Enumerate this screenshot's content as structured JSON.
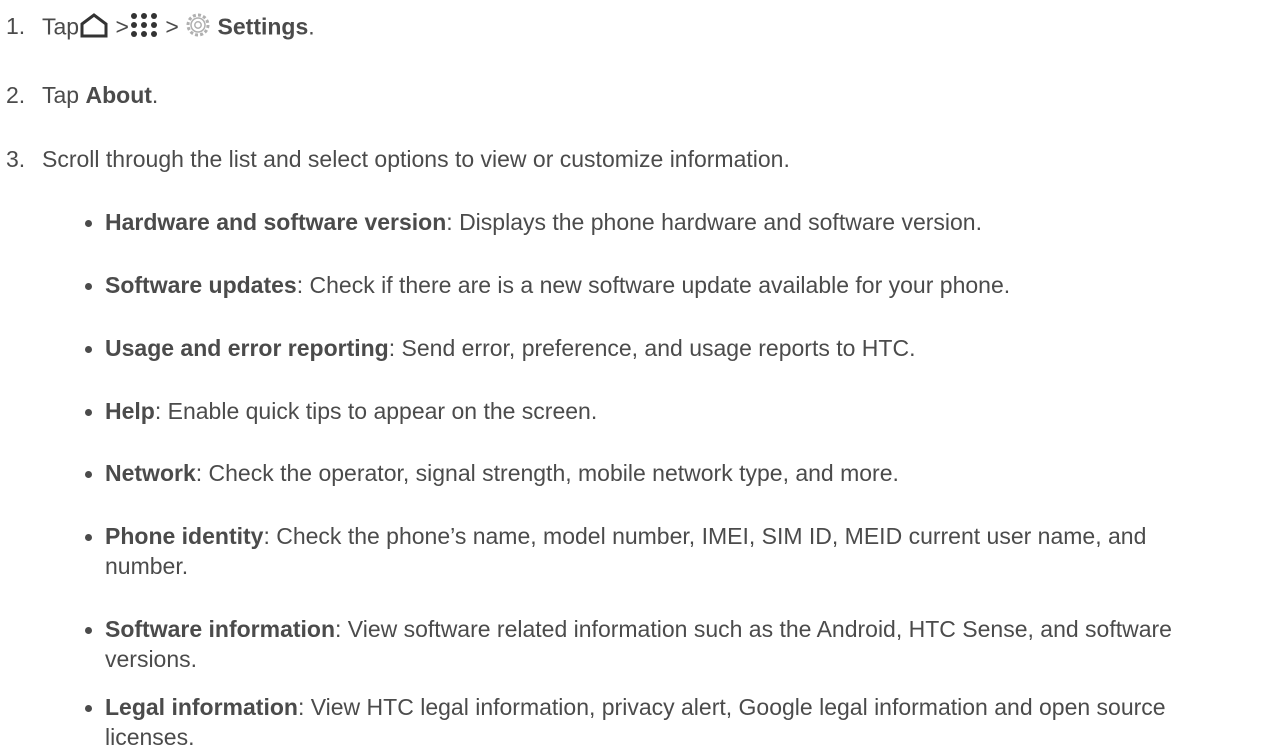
{
  "steps": [
    {
      "num": "1.",
      "parts": {
        "pre": "Tap",
        "sep1": ">",
        "sep2": ">",
        "label": "Settings",
        "post": "."
      },
      "icons": [
        "home-icon",
        "apps-grid-icon",
        "settings-gear-icon"
      ]
    },
    {
      "num": "2.",
      "pre": "Tap ",
      "bold": "About",
      "post": "."
    },
    {
      "num": "3.",
      "text": "Scroll through the list and select options to view or customize information."
    }
  ],
  "options": [
    {
      "label": "Hardware and software version",
      "desc": ": Displays the phone hardware and software version."
    },
    {
      "label": "Software updates",
      "desc": ": Check if there are is a new software update available for your phone."
    },
    {
      "label": "Usage and error reporting",
      "desc": ": Send error, preference, and usage reports to HTC."
    },
    {
      "label": "Help",
      "desc": ": Enable quick tips to appear on the screen."
    },
    {
      "label": "Network",
      "desc": ": Check the operator, signal strength, mobile network type, and more."
    },
    {
      "label": "Phone identity",
      "desc": ": Check the phone’s name, model number, IMEI, SIM ID, MEID current user name, and number."
    },
    {
      "label": "Software information",
      "desc": ": View software related information such as the Android, HTC Sense, and software versions."
    },
    {
      "label": "Legal information",
      "desc": ": View HTC legal information, privacy alert, Google legal information and open source licenses."
    }
  ],
  "colors": {
    "text": "#4b4b4b",
    "icon": "#333333",
    "gear": "#b0b0b0"
  }
}
